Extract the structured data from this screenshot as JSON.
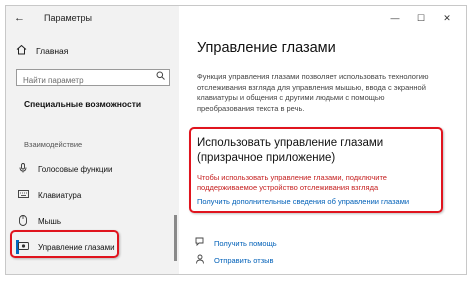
{
  "window": {
    "title": "Параметры",
    "controls": {
      "minimize": "—",
      "maximize": "☐",
      "close": "✕"
    }
  },
  "sidebar": {
    "back_icon": "back-arrow-icon",
    "home": {
      "icon": "home-icon",
      "label": "Главная"
    },
    "search": {
      "placeholder": "Найти параметр",
      "icon": "search-icon"
    },
    "section_title": "Специальные возможности",
    "group_title": "Взаимодействие",
    "items": [
      {
        "icon": "microphone-icon",
        "label": "Голосовые функции"
      },
      {
        "icon": "keyboard-icon",
        "label": "Клавиатура"
      },
      {
        "icon": "mouse-icon",
        "label": "Мышь"
      },
      {
        "icon": "eye-icon",
        "label": "Управление глазами",
        "active": true
      }
    ]
  },
  "main": {
    "page_title": "Управление глазами",
    "description": "Функция управления глазами позволяет использовать технологию отслеживания взгляда для управления мышью, ввода с экранной клавиатуры и общения с другими людьми с помощью преобразования текста в речь.",
    "setting_title": "Использовать управление глазами (призрачное приложение)",
    "warning": "Чтобы использовать управление глазами, подключите поддерживаемое устройство отслеживания взгляда",
    "more_link": "Получить дополнительные сведения об управлении глазами",
    "help": [
      {
        "icon": "help-chat-icon",
        "label": "Получить помощь"
      },
      {
        "icon": "feedback-icon",
        "label": "Отправить отзыв"
      }
    ]
  },
  "colors": {
    "accent": "#0067c0",
    "highlight_border": "#e0141e",
    "warning_text": "#c41e1e",
    "link": "#0060b8"
  }
}
